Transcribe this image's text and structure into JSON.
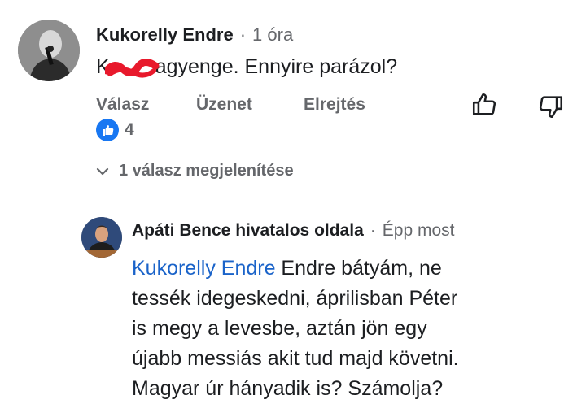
{
  "comment": {
    "author": "Kukorelly Endre",
    "separator": "·",
    "time": "1 óra",
    "text_prefix": "K",
    "text_suffix": "agyenge. Ennyire parázol?",
    "actions": {
      "reply": "Válasz",
      "message": "Üzenet",
      "hide": "Elrejtés"
    },
    "reaction_count": "4",
    "replies_toggle": "1 válasz megjelenítése",
    "like_color": "#1877f2",
    "redaction_color": "#e8192c"
  },
  "reply": {
    "author": "Apáti Bence hivatalos oldala",
    "separator": "·",
    "time": "Épp most",
    "mention": "Kukorelly Endre",
    "lines": [
      " Endre bátyám, ne",
      "tessék idegeskedni, áprilisban Péter",
      "is megy a levesbe, aztán jön egy",
      "újabb messiás akit tud majd követni.",
      "Magyar úr hányadik is? Számolja?"
    ],
    "mention_color": "#1a63c9"
  },
  "icons": {
    "like": "thumbs-up-outline-icon",
    "dislike": "thumbs-down-outline-icon",
    "reaction": "like-reaction-icon",
    "toggle": "chevron-down-icon"
  }
}
